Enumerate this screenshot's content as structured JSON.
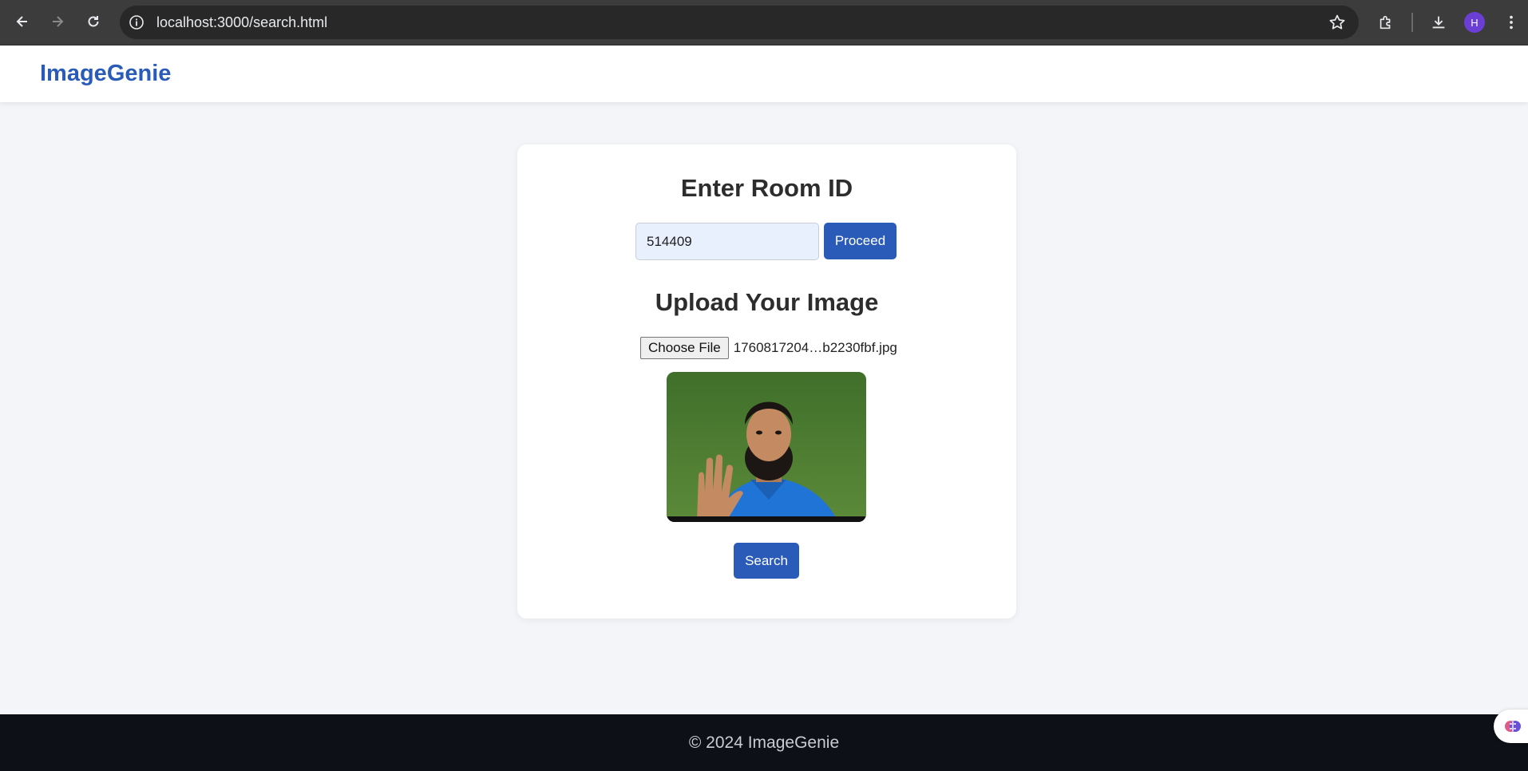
{
  "browser": {
    "url": "localhost:3000/search.html",
    "profile_initial": "H"
  },
  "header": {
    "brand": "ImageGenie"
  },
  "room": {
    "heading": "Enter Room ID",
    "input_value": "514409",
    "proceed_label": "Proceed"
  },
  "upload": {
    "heading": "Upload Your Image",
    "choose_label": "Choose File",
    "file_name": "1760817204…b2230fbf.jpg",
    "preview_icon": "photo-preview",
    "search_label": "Search"
  },
  "footer": {
    "text": "© 2024 ImageGenie"
  },
  "colors": {
    "brand": "#2a5bb8",
    "page_bg": "#f3f5f9",
    "footer_bg": "#0d1117"
  }
}
